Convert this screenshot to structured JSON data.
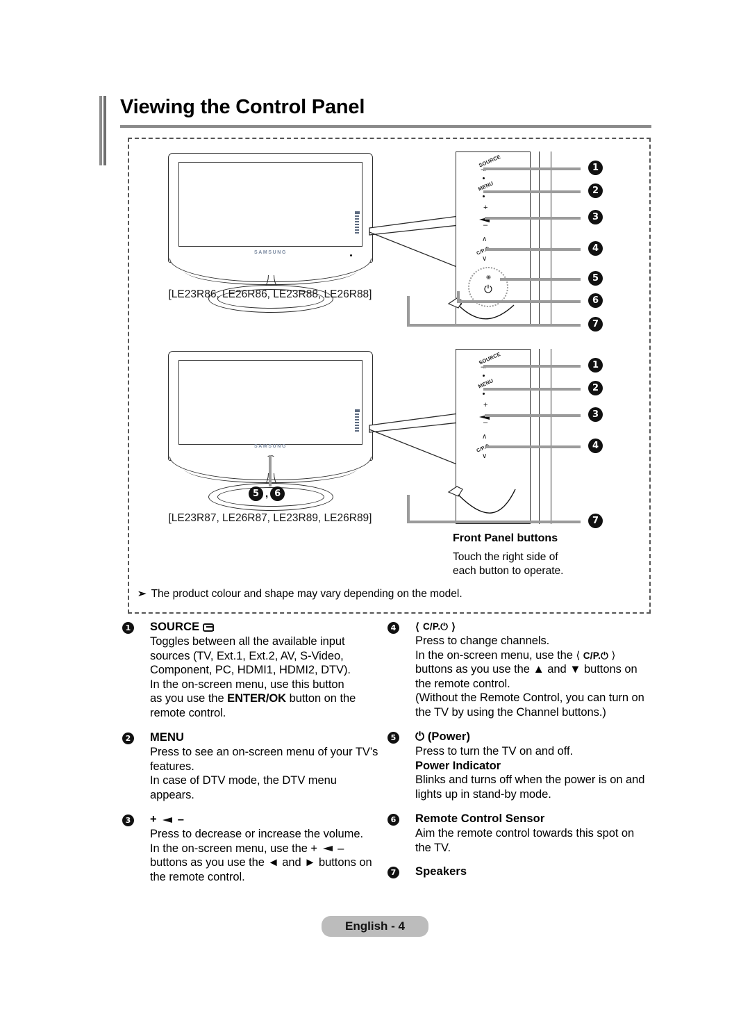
{
  "document": {
    "title": "Viewing the Control Panel",
    "footer_label": "English - 4"
  },
  "diagram": {
    "model_group_1": "[LE23R86, LE26R86, LE23R88, LE26R88]",
    "model_group_2": "[LE23R87, LE26R87, LE23R89, LE26R89]",
    "front_panel_title": "Front Panel buttons",
    "front_panel_sub_line1": "Touch the right side of",
    "front_panel_sub_line2": "each button to operate.",
    "note_arrow": "➢",
    "note_text": "The product colour and shape may vary depending on the model.",
    "tv_logo": "SAMSUNG",
    "panel_labels": {
      "source": "SOURCE",
      "menu": "MENU",
      "plus": "+",
      "minus": "–",
      "chan_up": "∧",
      "chan_label": "C/P.⏻",
      "chan_down": "∨",
      "power": "⏻"
    },
    "callouts_panel_1": [
      "1",
      "2",
      "3",
      "4",
      "5",
      "6",
      "7"
    ],
    "callouts_panel_2": [
      "1",
      "2",
      "3",
      "4",
      "7"
    ],
    "pair_callout": [
      "5",
      "6"
    ],
    "pair_separator": ","
  },
  "descriptions": {
    "left": [
      {
        "num": "1",
        "heading": "SOURCE",
        "heading_icon": "source-icon",
        "lines": [
          "Toggles between all the available input",
          "sources (TV, Ext.1, Ext.2, AV, S-Video,",
          "Component, PC, HDMI1, HDMI2, DTV).",
          "In the on-screen menu, use this button",
          "as you use the ENTER/OK button on the",
          "remote control."
        ],
        "bold_terms": [
          "ENTER/OK"
        ]
      },
      {
        "num": "2",
        "heading": "MENU",
        "lines": [
          "Press to see an on-screen menu of your TV’s",
          "features.",
          "In case of DTV mode, the DTV menu",
          "appears."
        ]
      },
      {
        "num": "3",
        "heading": "+ ▬ –",
        "heading_icon": "volume-icon",
        "lines": [
          "Press to decrease or increase the volume.",
          "In the on-screen menu, use the +  –",
          "buttons as you use the ◄ and ► buttons on",
          "the remote control."
        ]
      }
    ],
    "right": [
      {
        "num": "4",
        "heading": "〈 C/P.⏻ 〉",
        "lines": [
          "Press to change channels.",
          "In the on-screen menu, use the 〈 C/P.⏻ 〉",
          "buttons  as you use the ▲ and ▼ buttons on",
          "the remote control.",
          "(Without the Remote Control, you can turn on",
          "the TV by using the Channel buttons.)"
        ]
      },
      {
        "num": "5",
        "heading": "⏻ (Power)",
        "lines": [
          "Press to turn the TV on and off."
        ],
        "subheading": "Power Indicator",
        "sublines": [
          "Blinks and turns off when the power is on and",
          "lights up in stand-by mode."
        ]
      },
      {
        "num": "6",
        "heading": "Remote Control Sensor",
        "lines": [
          "Aim the remote control towards this spot on",
          "the TV."
        ]
      },
      {
        "num": "7",
        "heading": "Speakers",
        "lines": []
      }
    ]
  }
}
